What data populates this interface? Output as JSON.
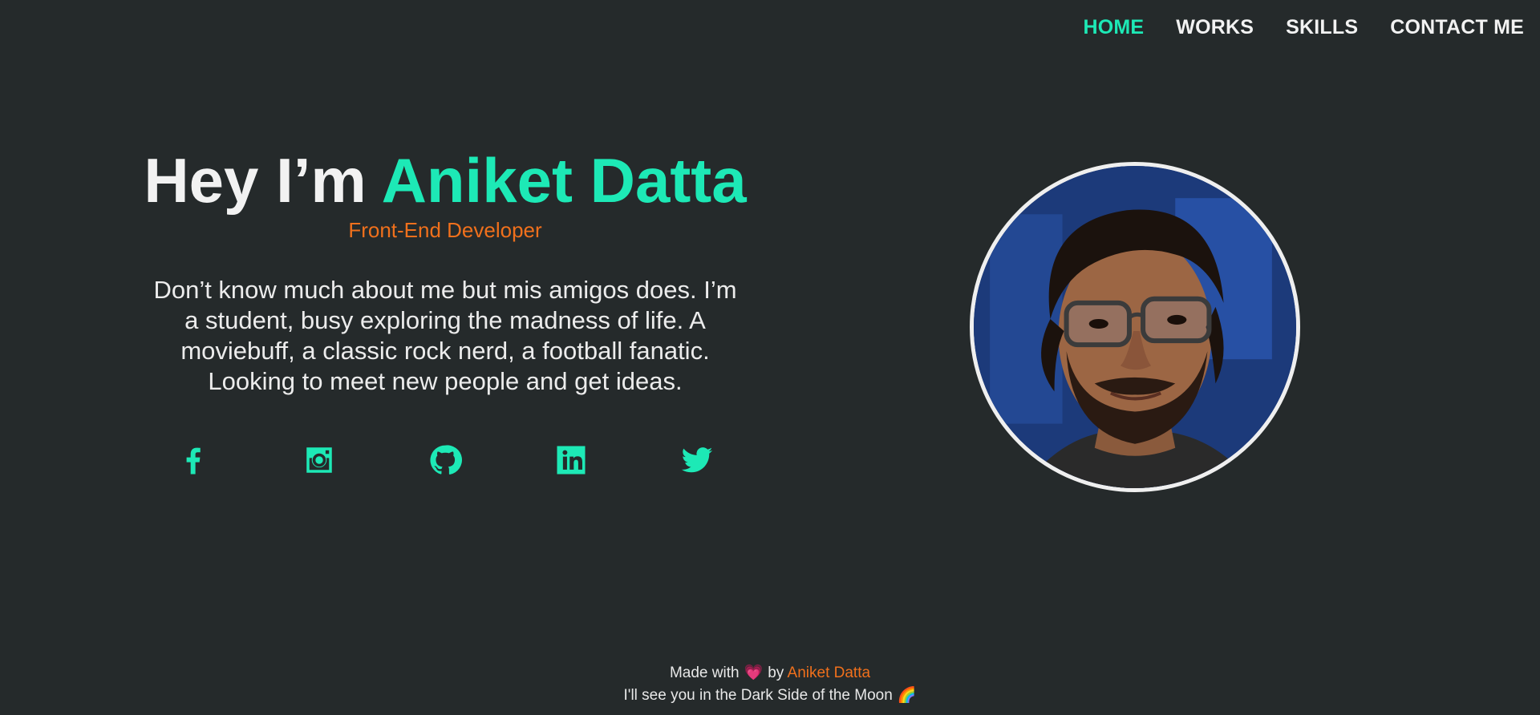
{
  "nav": {
    "items": [
      {
        "label": "HOME",
        "active": true
      },
      {
        "label": "WORKS",
        "active": false
      },
      {
        "label": "SKILLS",
        "active": false
      },
      {
        "label": "CONTACT ME",
        "active": false
      }
    ]
  },
  "hero": {
    "greeting": "Hey I’m ",
    "name": "Aniket Datta",
    "subtitle": "Front-End Developer",
    "bio": "Don’t know much about me but mis amigos does. I’m a student, busy exploring the madness of life. A moviebuff, a classic rock nerd, a football fanatic. Looking to meet new people and get ideas."
  },
  "socials": [
    {
      "icon": "facebook-icon"
    },
    {
      "icon": "instagram-icon"
    },
    {
      "icon": "github-icon"
    },
    {
      "icon": "linkedin-icon"
    },
    {
      "icon": "twitter-icon"
    }
  ],
  "footer": {
    "made_with": "Made with",
    "heart": "💗",
    "by": "by",
    "author": "Aniket Datta",
    "tagline": "I'll see you in the Dark Side of the Moon",
    "rainbow": "🌈"
  },
  "colors": {
    "background": "#252a2b",
    "accent": "#1de9b6",
    "secondary": "#f0701c",
    "text": "#f2f2f2"
  }
}
